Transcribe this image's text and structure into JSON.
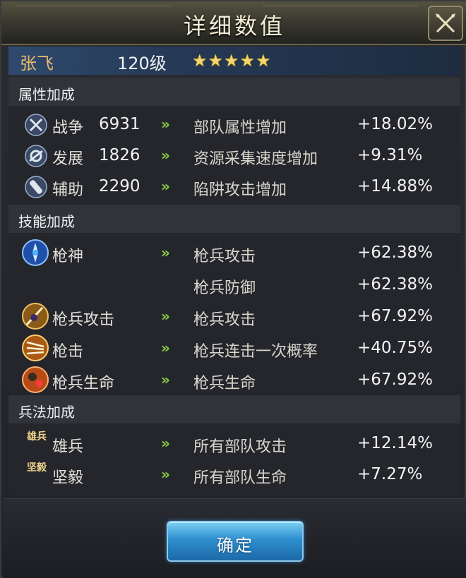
{
  "dialog": {
    "title": "详细数值",
    "confirm_label": "确定"
  },
  "hero": {
    "name": "张飞",
    "level": "120级",
    "stars": "★★★★★",
    "star_count": 5
  },
  "sections": [
    {
      "header": "属性加成",
      "rows": [
        {
          "icon": "crossed-swords-icon",
          "name": "战争",
          "number": "6931",
          "arrow": "»",
          "effect": "部队属性增加",
          "value": "+18.02%"
        },
        {
          "icon": "development-icon",
          "name": "发展",
          "number": "1826",
          "arrow": "»",
          "effect": "资源采集速度增加",
          "value": "+9.31%"
        },
        {
          "icon": "support-icon",
          "name": "辅助",
          "number": "2290",
          "arrow": "»",
          "effect": "陷阱攻击增加",
          "value": "+14.88%"
        }
      ]
    },
    {
      "header": "技能加成",
      "rows": [
        {
          "icon": "spear-god-skill-icon",
          "name": "枪神",
          "arrow": "»",
          "effect": "枪兵攻击",
          "value": "+62.38%"
        },
        {
          "effect": "枪兵防御",
          "value": "+62.38%"
        },
        {
          "icon": "spearman-attack-skill-icon",
          "name": "枪兵攻击",
          "arrow": "»",
          "effect": "枪兵攻击",
          "value": "+67.92%"
        },
        {
          "icon": "spear-strike-skill-icon",
          "name": "枪击",
          "arrow": "»",
          "effect": "枪兵连击一次概率",
          "value": "+40.75%"
        },
        {
          "icon": "spearman-life-skill-icon",
          "name": "枪兵生命",
          "arrow": "»",
          "effect": "枪兵生命",
          "value": "+67.92%"
        }
      ]
    },
    {
      "header": "兵法加成",
      "rows": [
        {
          "icon": "xiongbing-tactic-icon",
          "icon_text": "雄兵",
          "name": "雄兵",
          "arrow": "»",
          "effect": "所有部队攻击",
          "value": "+12.14%"
        },
        {
          "icon": "jianyi-tactic-icon",
          "icon_text": "坚毅",
          "name": "坚毅",
          "arrow": "»",
          "effect": "所有部队生命",
          "value": "+7.27%"
        }
      ]
    }
  ],
  "colors": {
    "accent_arrow": "#8cd13c",
    "hero_name": "#e9b86a",
    "star": "#f8d56a",
    "button": "#2e8fce"
  }
}
